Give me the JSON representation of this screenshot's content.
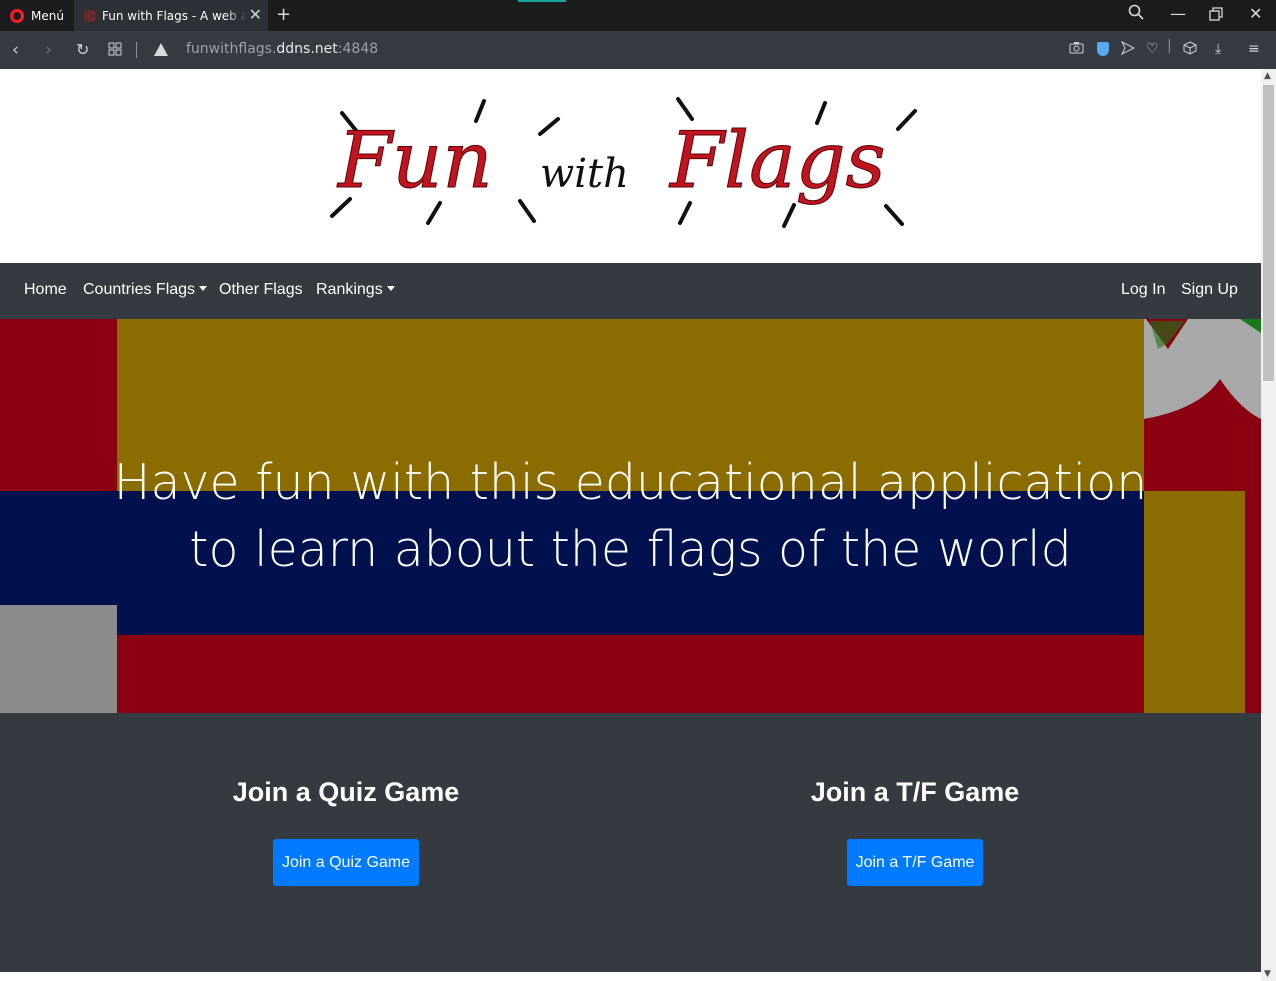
{
  "browser": {
    "menu_label": "Menú",
    "tab_title": "Fun with Flags - A web app",
    "url_host": "funwithflags.",
    "url_domain": "ddns.net",
    "url_port": ":4848"
  },
  "logo": {
    "word1": "Fun",
    "word2": "with",
    "word3": "Flags",
    "colors": {
      "script": "#c0151f",
      "dark": "#111111"
    }
  },
  "nav": {
    "home": "Home",
    "countries_flags": "Countries Flags",
    "other_flags": "Other Flags",
    "rankings": "Rankings",
    "log_in": "Log In",
    "sign_up": "Sign Up"
  },
  "hero": {
    "line1": "Have fun with this educational application",
    "line2": "to learn about the flags of the world"
  },
  "games": {
    "quiz_title": "Join a Quiz Game",
    "quiz_button": "Join a Quiz Game",
    "tf_title": "Join a T/F Game",
    "tf_button": "Join a T/F Game"
  },
  "colors": {
    "navbar": "#343a40",
    "button": "#007bff",
    "flag_yellow": "#8a6c00",
    "flag_blue": "#00114e",
    "flag_red": "#8b0010"
  }
}
